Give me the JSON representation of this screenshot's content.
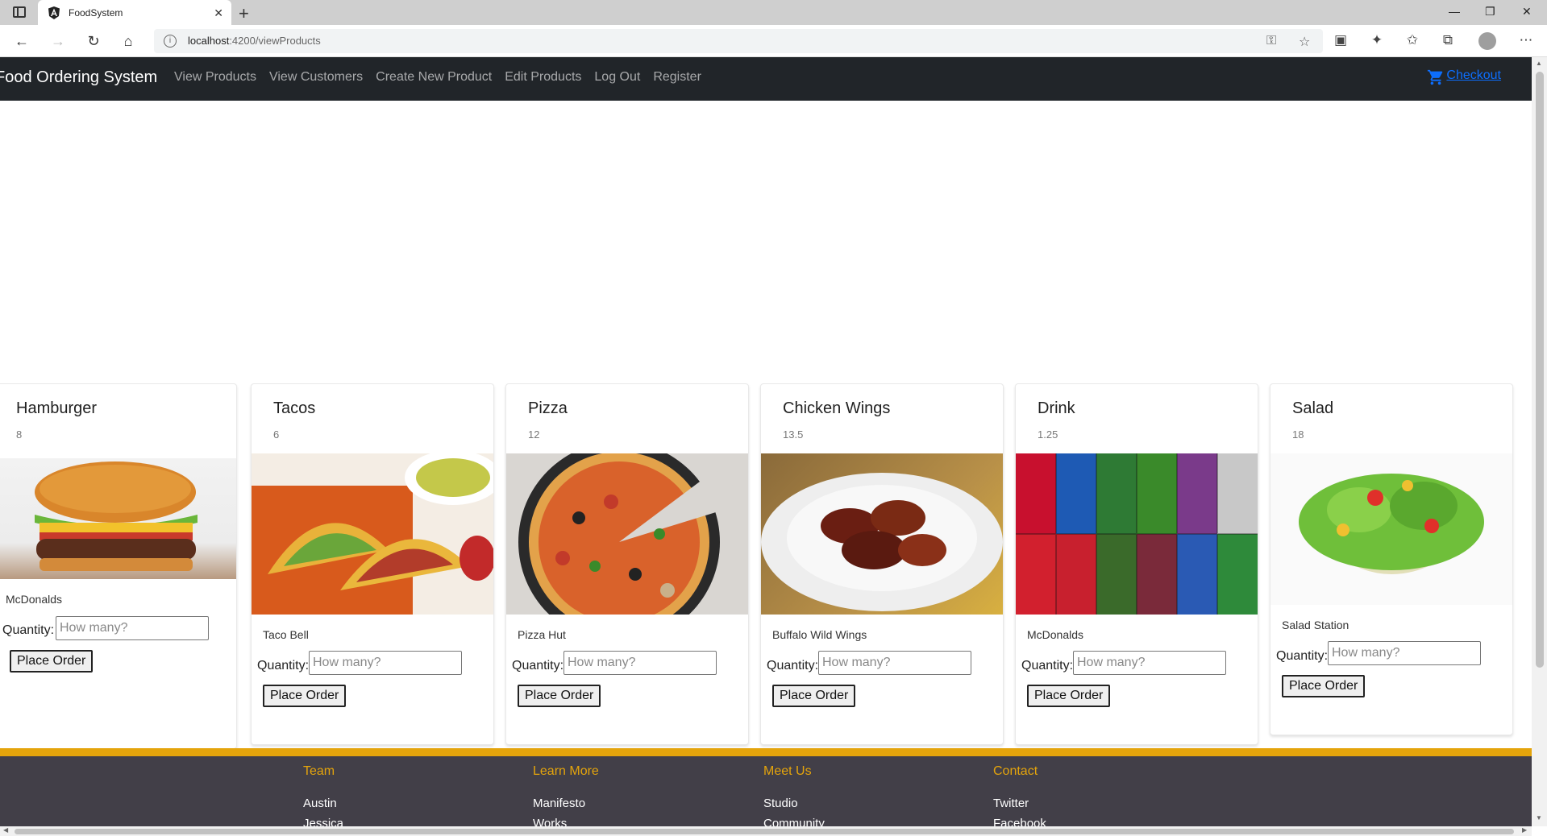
{
  "browser": {
    "tab_title": "FoodSystem",
    "url_host": "localhost",
    "url_rest": ":4200/viewProducts"
  },
  "navbar": {
    "brand": "Food Ordering System",
    "links": [
      "View Products",
      "View Customers",
      "Create New Product",
      "Edit Products",
      "Log Out",
      "Register"
    ],
    "checkout": "Checkout"
  },
  "products": [
    {
      "name": "Hamburger",
      "price": "8",
      "vendor": "McDonalds",
      "image": "hamburger"
    },
    {
      "name": "Tacos",
      "price": "6",
      "vendor": "Taco Bell",
      "image": "tacos"
    },
    {
      "name": "Pizza",
      "price": "12",
      "vendor": "Pizza Hut",
      "image": "pizza"
    },
    {
      "name": "Chicken Wings",
      "price": "13.5",
      "vendor": "Buffalo Wild Wings",
      "image": "chicken-wings"
    },
    {
      "name": "Drink",
      "price": "1.25",
      "vendor": "McDonalds",
      "image": "soda-cans"
    },
    {
      "name": "Salad",
      "price": "18",
      "vendor": "Salad Station",
      "image": "salad"
    }
  ],
  "product_form": {
    "quantity_label": "Quantity:",
    "quantity_placeholder": "How many?",
    "order_button": "Place Order"
  },
  "footer": {
    "columns": [
      {
        "heading": "Team",
        "links": [
          "Austin",
          "Jessica"
        ]
      },
      {
        "heading": "Learn More",
        "links": [
          "Manifesto",
          "Works"
        ]
      },
      {
        "heading": "Meet Us",
        "links": [
          "Studio",
          "Community"
        ]
      },
      {
        "heading": "Contact",
        "links": [
          "Twitter",
          "Facebook"
        ]
      }
    ]
  },
  "colors": {
    "navbar_bg": "#212529",
    "footer_bg": "#423f48",
    "footer_accent": "#e4a40c",
    "link": "#0d6efd"
  }
}
